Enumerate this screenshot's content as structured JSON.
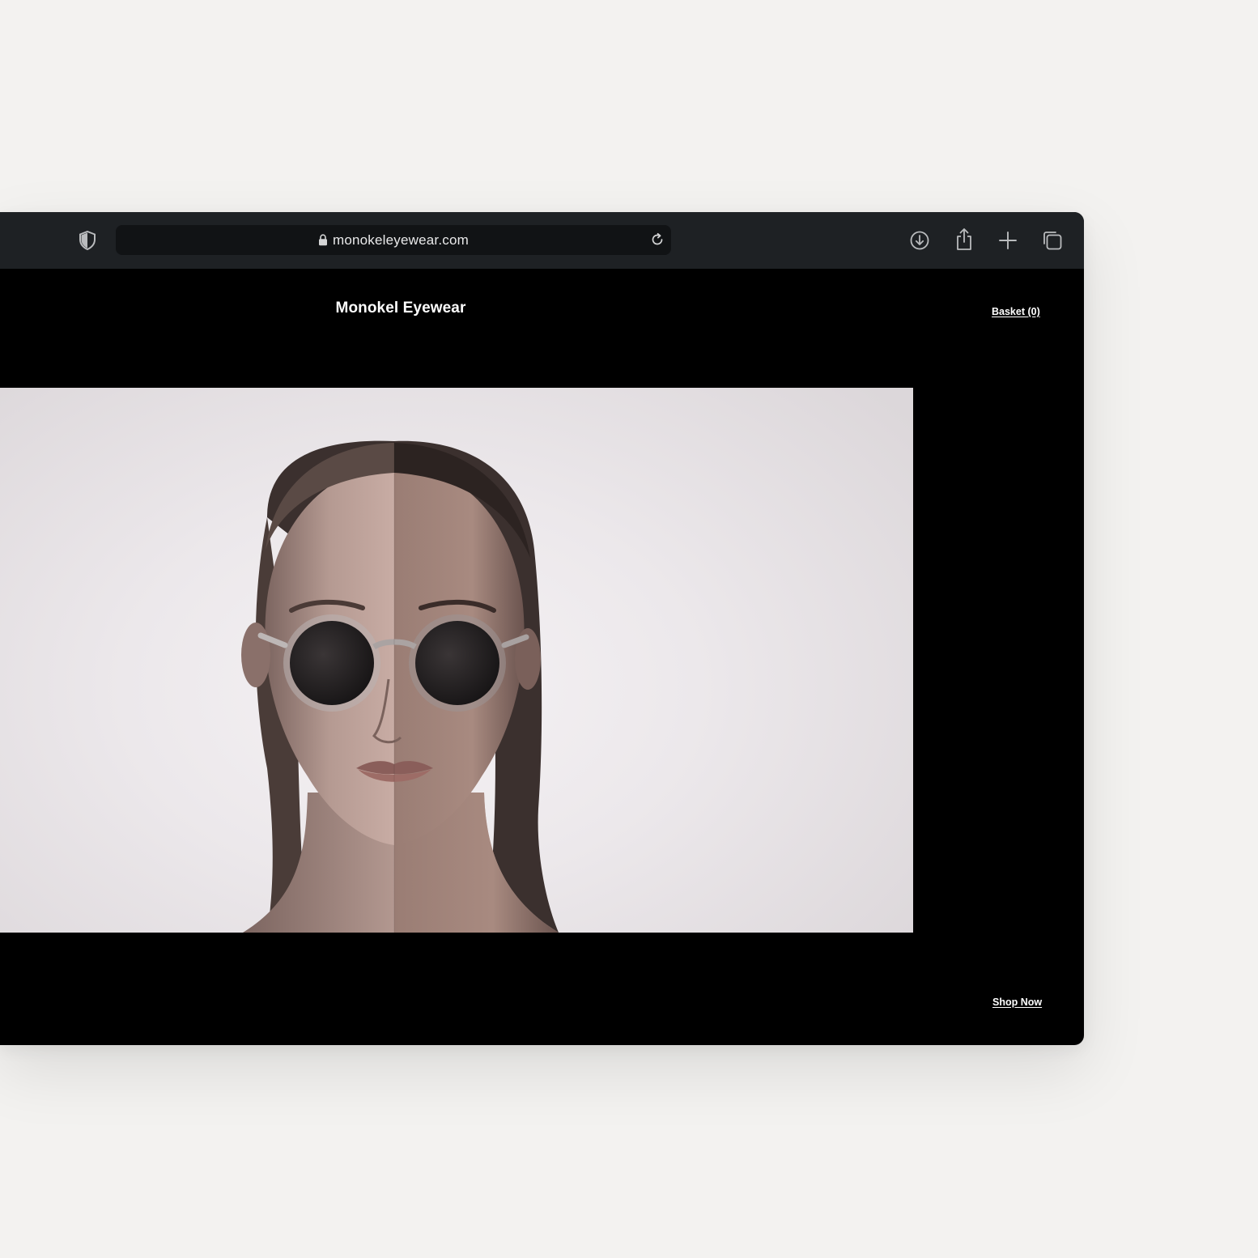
{
  "browser": {
    "url": "monokeleyewear.com",
    "icons": {
      "privacy": "shield-icon",
      "secure": "lock-icon",
      "reload": "reload-icon",
      "download": "download-icon",
      "share": "share-icon",
      "new_tab": "plus-icon",
      "tabs": "tabs-overview-icon"
    }
  },
  "site": {
    "brand": "Monokel Eyewear",
    "basket_label": "Basket (0)",
    "cta_label": "Shop Now",
    "hero_image": "portrait-with-sunglasses"
  },
  "colors": {
    "toolbar": "#1e2124",
    "urlbar": "#111315",
    "page_bg": "#000000",
    "desk_bg": "#f3f2f0",
    "text": "#ffffff"
  }
}
